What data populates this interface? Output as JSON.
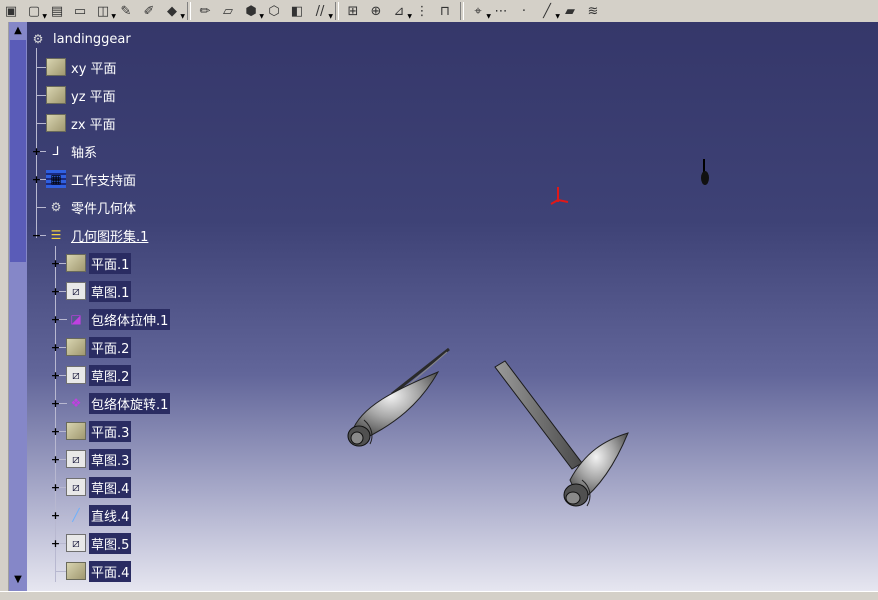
{
  "toolbar": {
    "icons": [
      "part-icon",
      "new-icon",
      "assembly-icon",
      "drafting-icon",
      "analysis-icon",
      "draw-icon",
      "pencil-icon",
      "box-icon",
      "sketch-icon",
      "paint-icon",
      "extrude-icon",
      "solid-icon",
      "shell-icon",
      "stripe-icon",
      "measure-icon",
      "grid-icon",
      "dimension-icon",
      "hierarchy-icon",
      "constraint-icon",
      "compass-icon",
      "snap-icon",
      "point-icon",
      "line-icon",
      "plane-tool-icon",
      "layer-icon"
    ]
  },
  "tree": {
    "root": "landinggear",
    "items": [
      {
        "label": "xy 平面",
        "icon": "plane-icon"
      },
      {
        "label": "yz 平面",
        "icon": "plane-icon"
      },
      {
        "label": "zx 平面",
        "icon": "plane-icon"
      },
      {
        "label": "轴系",
        "icon": "axis-icon"
      },
      {
        "label": "工作支持面",
        "icon": "work-support-icon"
      },
      {
        "label": "零件几何体",
        "icon": "part-body-icon"
      },
      {
        "label": "几何图形集.1",
        "icon": "geometric-set-icon"
      }
    ],
    "children": [
      {
        "label": "平面.1",
        "icon": "plane-icon"
      },
      {
        "label": "草图.1",
        "icon": "sketch-icon"
      },
      {
        "label": "包络体拉伸.1",
        "icon": "volume-extrude-icon"
      },
      {
        "label": "平面.2",
        "icon": "plane-icon"
      },
      {
        "label": "草图.2",
        "icon": "sketch-icon"
      },
      {
        "label": "包络体旋转.1",
        "icon": "volume-revolve-icon"
      },
      {
        "label": "平面.3",
        "icon": "plane-icon"
      },
      {
        "label": "草图.3",
        "icon": "sketch-icon"
      },
      {
        "label": "草图.4",
        "icon": "sketch-icon"
      },
      {
        "label": "直线.4",
        "icon": "line-icon"
      },
      {
        "label": "草图.5",
        "icon": "sketch-icon"
      },
      {
        "label": "平面.4",
        "icon": "plane-icon"
      }
    ]
  },
  "colors": {
    "viewport_top": "#35376a",
    "viewport_bottom": "#e6e6f0",
    "highlight": "#2a2c62",
    "scrollbar": "#8587c8",
    "axis_marker": "#e01818"
  }
}
